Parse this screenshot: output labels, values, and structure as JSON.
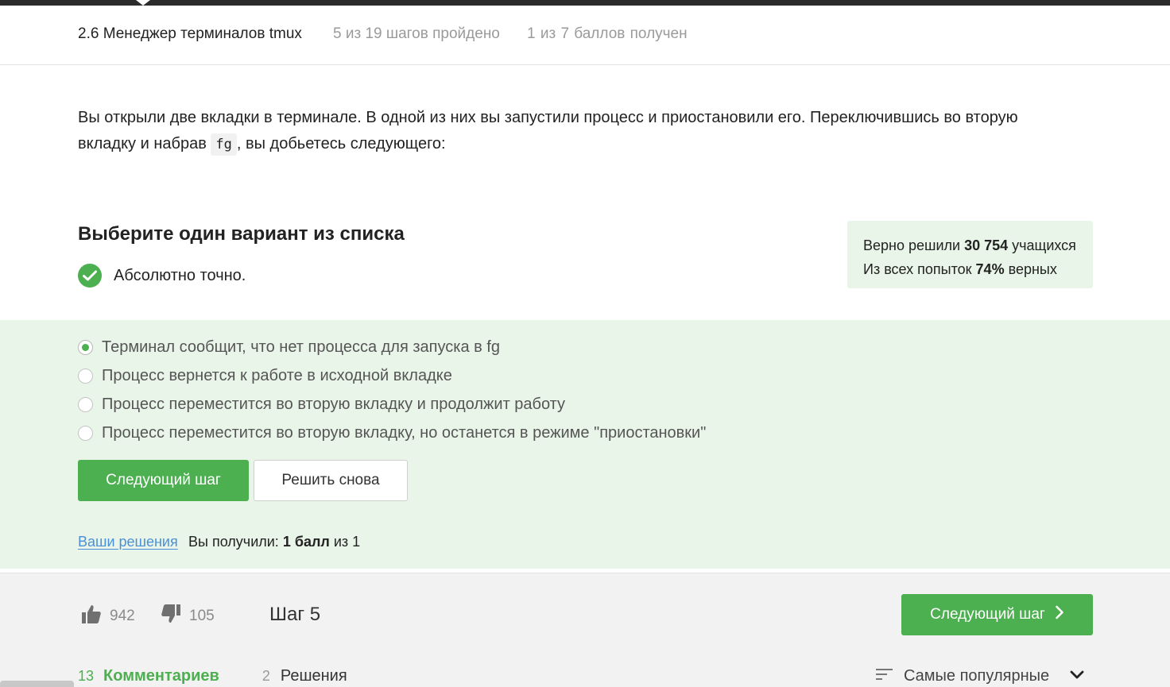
{
  "header": {
    "lesson_title": "2.6 Менеджер терминалов tmux",
    "steps_progress": "5 из 19 шагов пройдено",
    "points_progress": "1 из 7 баллов  получен"
  },
  "question": {
    "text_before": "Вы открыли две вкладки в терминале. В одной из них вы запустили процесс и приостановили его. Переключившись во вторую вкладку и набрав ",
    "code": "fg",
    "text_after": ", вы добьетесь следующего:"
  },
  "quiz": {
    "title": "Выберите один вариант из списка",
    "feedback": "Абсолютно точно.",
    "stats": {
      "solved_prefix": "Верно решили ",
      "solved_count": "30 754",
      "solved_suffix": " учащихся",
      "attempts_prefix": "Из всех попыток ",
      "attempts_percent": "74%",
      "attempts_suffix": " верных"
    },
    "options": [
      {
        "label": "Терминал сообщит, что нет процесса для запуска в fg",
        "selected": true
      },
      {
        "label": "Процесс вернется к работе в исходной вкладке",
        "selected": false
      },
      {
        "label": "Процесс переместится во вторую вкладку и продолжит работу",
        "selected": false
      },
      {
        "label": "Процесс переместится во вторую вкладку, но останется в режиме \"приостановки\"",
        "selected": false
      }
    ],
    "next_button": "Следующий шаг",
    "retry_button": "Решить снова",
    "solutions_link": "Ваши решения",
    "score_prefix": "Вы получили: ",
    "score_value": "1 балл",
    "score_suffix": " из 1"
  },
  "footer": {
    "likes": "942",
    "dislikes": "105",
    "step_label": "Шаг 5",
    "next_step_button": "Следующий шаг",
    "comments_count": "13",
    "comments_tab": "Комментариев",
    "solutions_count": "2",
    "solutions_tab": "Решения",
    "sort_label": "Самые популярные"
  },
  "colors": {
    "accent": "#4caf50",
    "answer_background": "#e9f5e9",
    "link": "#4a90d9"
  },
  "icons": [
    "check-icon",
    "thumbs-up-icon",
    "thumbs-down-icon",
    "chevron-right-icon",
    "sort-icon",
    "chevron-down-icon"
  ]
}
